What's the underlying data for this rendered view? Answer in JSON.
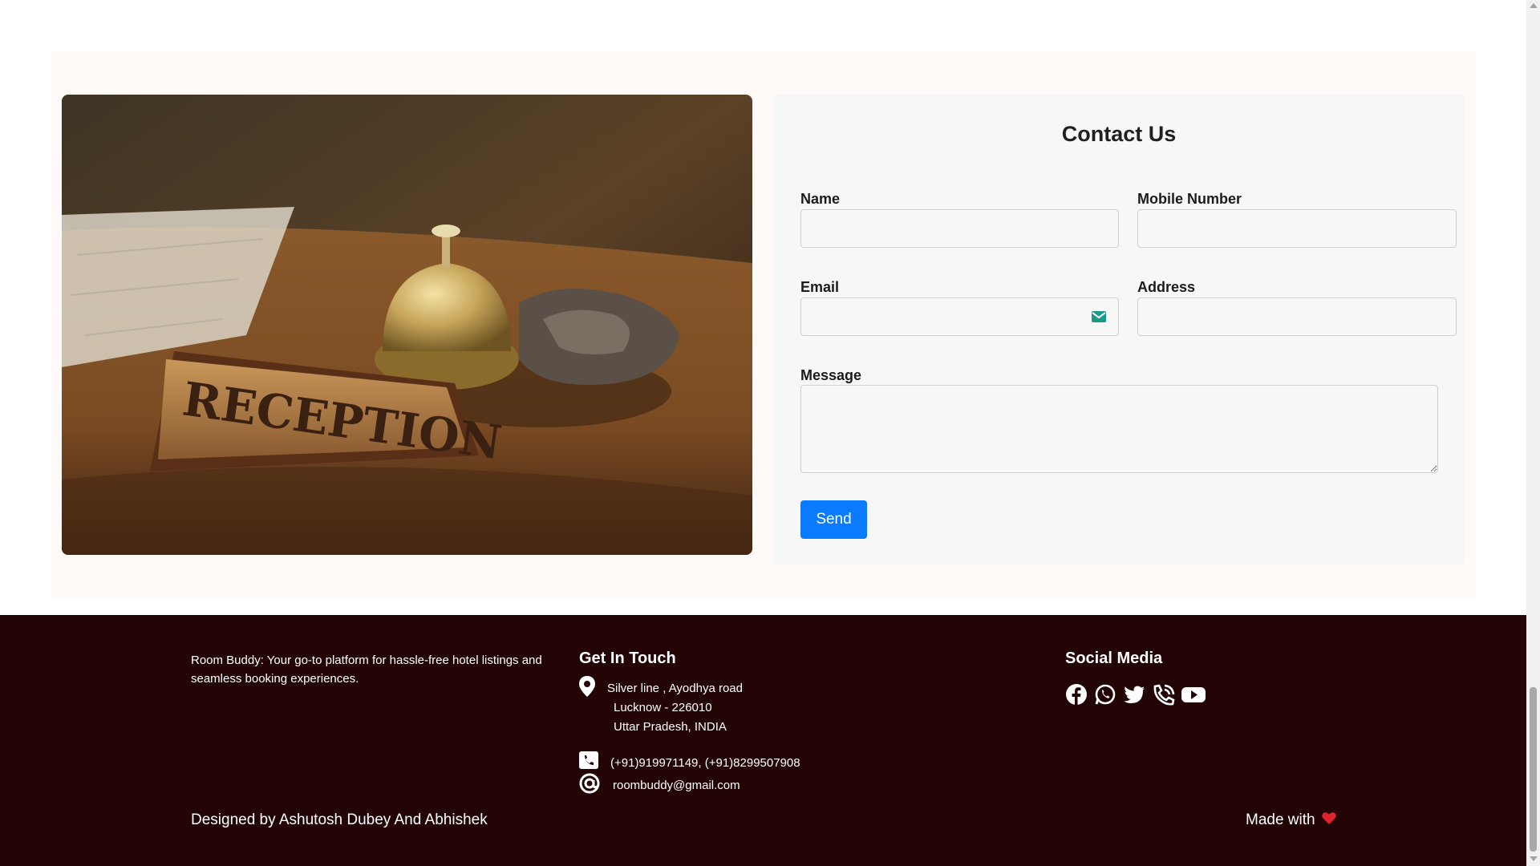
{
  "contact": {
    "title": "Contact Us",
    "name_label": "Name",
    "mobile_label": "Mobile Number",
    "email_label": "Email",
    "address_label": "Address",
    "message_label": "Message",
    "name_value": "",
    "mobile_value": "",
    "email_value": "",
    "address_value": "",
    "message_value": "",
    "send_label": "Send"
  },
  "footer": {
    "about": "Room Buddy: Your go-to platform for hassle-free hotel listings and seamless booking experiences.",
    "get_in_touch_title": "Get In Touch",
    "address_line1": "Silver line , Ayodhya road",
    "address_line2": "Lucknow - 226010",
    "address_line3": "Uttar Pradesh, INDIA",
    "phone": "(+91)919971149, (+91)8299507908",
    "email": "roombuddy@gmail.com",
    "social_title": "Social Media",
    "social_icons": [
      "facebook-icon",
      "whatsapp-icon",
      "twitter-icon",
      "phone-call-icon",
      "youtube-icon"
    ],
    "designed_by": "Designed by Ashutosh Dubey And Abhishek",
    "made_with": "Made with"
  },
  "colors": {
    "footer_bg": "#230505",
    "send_button": "#0a7bff",
    "heart": "#e0242f",
    "email_icon": "#1a9b8a"
  }
}
